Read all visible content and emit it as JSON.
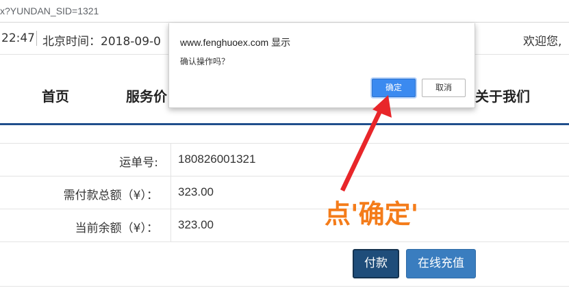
{
  "browser": {
    "url": "x?YUNDAN_SID=1321"
  },
  "topbar": {
    "time": "22:47",
    "beijing_time": "北京时间：2018-09-0",
    "welcome": "欢迎您,"
  },
  "nav": {
    "items": [
      {
        "label": "首页"
      },
      {
        "label": "服务价"
      },
      {
        "label": "关于我们"
      }
    ],
    "accent_color": "#1f4e8c"
  },
  "form": {
    "rows": [
      {
        "label": "运单号:",
        "value": "180826001321"
      },
      {
        "label": "需付款总额（¥）：",
        "value": "323.00"
      },
      {
        "label": "当前余额（¥）：",
        "value": "323.00"
      }
    ],
    "pay_button": "付款",
    "recharge_button": "在线充值"
  },
  "dialog": {
    "title": "www.fenghuoex.com 显示",
    "message": "确认操作吗？",
    "ok_label": "确定",
    "cancel_label": "取消"
  },
  "annotation": {
    "text": "点'确定'",
    "color": "#f47c1a",
    "arrow_color": "#e8262a"
  }
}
